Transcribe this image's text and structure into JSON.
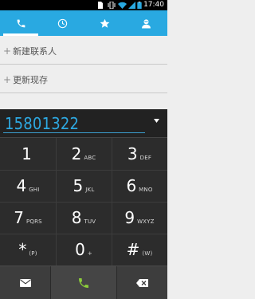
{
  "status_bar": {
    "time": "17:40",
    "icons": [
      "sd-card-icon",
      "vibrate-icon",
      "wifi-icon",
      "signal-icon",
      "battery-icon"
    ]
  },
  "tabs": [
    {
      "name": "phone",
      "icon": "phone-icon",
      "active": true
    },
    {
      "name": "recent",
      "icon": "clock-icon",
      "active": false
    },
    {
      "name": "favorites",
      "icon": "star-icon",
      "active": false
    },
    {
      "name": "contacts",
      "icon": "person-icon",
      "active": false
    }
  ],
  "suggestions": [
    {
      "plus": "+",
      "label": "新建联系人"
    },
    {
      "plus": "+",
      "label": "更新现存"
    }
  ],
  "dialer": {
    "number": "15801322",
    "keys": [
      {
        "digit": "1",
        "letters": ""
      },
      {
        "digit": "2",
        "letters": "ABC"
      },
      {
        "digit": "3",
        "letters": "DEF"
      },
      {
        "digit": "4",
        "letters": "GHI"
      },
      {
        "digit": "5",
        "letters": "JKL"
      },
      {
        "digit": "6",
        "letters": "MNO"
      },
      {
        "digit": "7",
        "letters": "PQRS"
      },
      {
        "digit": "8",
        "letters": "TUV"
      },
      {
        "digit": "9",
        "letters": "WXYZ"
      },
      {
        "digit": "*",
        "letters": "(P)"
      },
      {
        "digit": "0",
        "letters": "+"
      },
      {
        "digit": "#",
        "letters": "(W)"
      }
    ]
  },
  "actions": [
    "message-icon",
    "call-icon",
    "backspace-icon"
  ],
  "colors": {
    "accent": "#29a9e1",
    "number": "#2ea9e2",
    "call": "#8ccd3a"
  }
}
